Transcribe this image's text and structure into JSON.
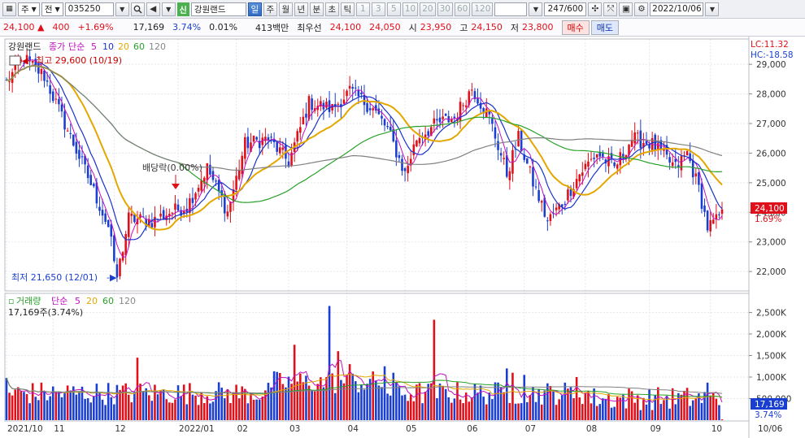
{
  "toolbar": {
    "market": "주",
    "exchange": "전",
    "code": "035250",
    "credit_badge": "신",
    "name": "강원랜드",
    "periods": [
      "일",
      "주",
      "월",
      "년",
      "분",
      "초",
      "틱"
    ],
    "active_period": "일",
    "intervals": [
      "1",
      "3",
      "5",
      "10",
      "20",
      "30",
      "60",
      "120"
    ],
    "count": "247",
    "count_max": "/600",
    "date": "2022/10/06"
  },
  "quote": {
    "price": "24,100",
    "change": "400",
    "change_pct": "+1.69%",
    "volume": "17,169",
    "volume_ratio": "3.74%",
    "turnover": "0.01%",
    "amount": "413백만",
    "best_label": "최우선",
    "ask": "24,100",
    "bid": "24,050",
    "open_label": "시",
    "open": "23,950",
    "high_label": "고",
    "high": "24,150",
    "low_label": "저",
    "low": "23,800",
    "buy_label": "매수",
    "sell_label": "매도"
  },
  "price_panel": {
    "legend": {
      "name": "강원랜드",
      "price_type": "종가",
      "ma_label": "단순",
      "ma_periods": [
        "5",
        "10",
        "20",
        "60",
        "120"
      ]
    },
    "max_annotation": "최고 29,600 (10/19)",
    "min_annotation": "최저 21,650 (12/01)",
    "dividend_annotation": "배당락(0.00%)",
    "lc": "LC:11.32",
    "hc": "HC:-18.58",
    "current_price_tag": "24,100",
    "current_change_tag": "1.69%",
    "y_ticks": [
      "29,000",
      "28,000",
      "27,000",
      "26,000",
      "25,000",
      "24,000",
      "23,000",
      "22,000"
    ]
  },
  "volume_panel": {
    "legend": {
      "title": "거래량",
      "ma_label": "단순",
      "ma_periods": [
        "5",
        "20",
        "60",
        "120"
      ]
    },
    "current_label": "17,169주(3.74%)",
    "current_tag": "17,169",
    "current_ratio_tag": "3.74%",
    "y_ticks": [
      "2,500K",
      "2,000K",
      "1,500K",
      "1,000K",
      "500,000"
    ]
  },
  "x_axis": {
    "labels": [
      {
        "text": "2021/10",
        "index": 0
      },
      {
        "text": "11",
        "index": 16
      },
      {
        "text": "12",
        "index": 37
      },
      {
        "text": "2022/01",
        "index": 59
      },
      {
        "text": "02",
        "index": 79
      },
      {
        "text": "03",
        "index": 97
      },
      {
        "text": "04",
        "index": 117
      },
      {
        "text": "05",
        "index": 137
      },
      {
        "text": "06",
        "index": 158
      },
      {
        "text": "07",
        "index": 178
      },
      {
        "text": "08",
        "index": 199
      },
      {
        "text": "09",
        "index": 221
      },
      {
        "text": "10",
        "index": 242
      }
    ],
    "right_label": "10/06"
  },
  "colors": {
    "up": "#e0101a",
    "down": "#1a3fd0",
    "ma5": "#c010c0",
    "ma10": "#1b33c9",
    "ma20": "#e3a800",
    "ma60": "#2aa12a",
    "ma120": "#808080"
  },
  "chart_data": {
    "type": "candlestick",
    "candle_count": 247,
    "x_range": [
      "2021/10",
      "2022/10/06"
    ],
    "y_price_range": [
      21500,
      29600
    ],
    "price_anchors": [
      {
        "i": 0,
        "c": 28400
      },
      {
        "i": 6,
        "c": 29200
      },
      {
        "i": 13,
        "c": 28600
      },
      {
        "i": 20,
        "c": 27000
      },
      {
        "i": 28,
        "c": 25200
      },
      {
        "i": 35,
        "c": 23500
      },
      {
        "i": 38,
        "c": 21800
      },
      {
        "i": 42,
        "c": 23800
      },
      {
        "i": 50,
        "c": 23700
      },
      {
        "i": 56,
        "c": 24000
      },
      {
        "i": 62,
        "c": 24200
      },
      {
        "i": 69,
        "c": 25500
      },
      {
        "i": 76,
        "c": 24000
      },
      {
        "i": 82,
        "c": 26300
      },
      {
        "i": 90,
        "c": 26500
      },
      {
        "i": 97,
        "c": 25700
      },
      {
        "i": 104,
        "c": 27700
      },
      {
        "i": 112,
        "c": 27500
      },
      {
        "i": 118,
        "c": 28100
      },
      {
        "i": 126,
        "c": 27500
      },
      {
        "i": 131,
        "c": 26800
      },
      {
        "i": 137,
        "c": 25300
      },
      {
        "i": 141,
        "c": 26500
      },
      {
        "i": 148,
        "c": 27000
      },
      {
        "i": 154,
        "c": 27200
      },
      {
        "i": 160,
        "c": 28200
      },
      {
        "i": 166,
        "c": 27200
      },
      {
        "i": 172,
        "c": 25300
      },
      {
        "i": 176,
        "c": 26500
      },
      {
        "i": 181,
        "c": 25000
      },
      {
        "i": 186,
        "c": 23700
      },
      {
        "i": 191,
        "c": 24300
      },
      {
        "i": 197,
        "c": 25300
      },
      {
        "i": 203,
        "c": 26000
      },
      {
        "i": 209,
        "c": 25500
      },
      {
        "i": 215,
        "c": 26500
      },
      {
        "i": 222,
        "c": 26300
      },
      {
        "i": 230,
        "c": 25500
      },
      {
        "i": 234,
        "c": 26000
      },
      {
        "i": 238,
        "c": 24800
      },
      {
        "i": 241,
        "c": 23500
      },
      {
        "i": 244,
        "c": 23700
      },
      {
        "i": 246,
        "c": 24100
      }
    ],
    "volume_range": [
      0,
      2700000
    ],
    "volume_spikes": [
      {
        "i": 0,
        "v": 980000
      },
      {
        "i": 45,
        "v": 1450000
      },
      {
        "i": 99,
        "v": 1750000
      },
      {
        "i": 111,
        "v": 2650000
      },
      {
        "i": 114,
        "v": 1600000
      },
      {
        "i": 118,
        "v": 1300000
      },
      {
        "i": 130,
        "v": 1250000
      },
      {
        "i": 133,
        "v": 1100000
      },
      {
        "i": 147,
        "v": 2330000
      },
      {
        "i": 172,
        "v": 1200000
      },
      {
        "i": 174,
        "v": 1100000
      },
      {
        "i": 178,
        "v": 1050000
      },
      {
        "i": 196,
        "v": 1000000
      },
      {
        "i": 241,
        "v": 870000
      }
    ],
    "series": [
      {
        "name": "5"
      },
      {
        "name": "10"
      },
      {
        "name": "20"
      },
      {
        "name": "60"
      },
      {
        "name": "120"
      }
    ]
  }
}
